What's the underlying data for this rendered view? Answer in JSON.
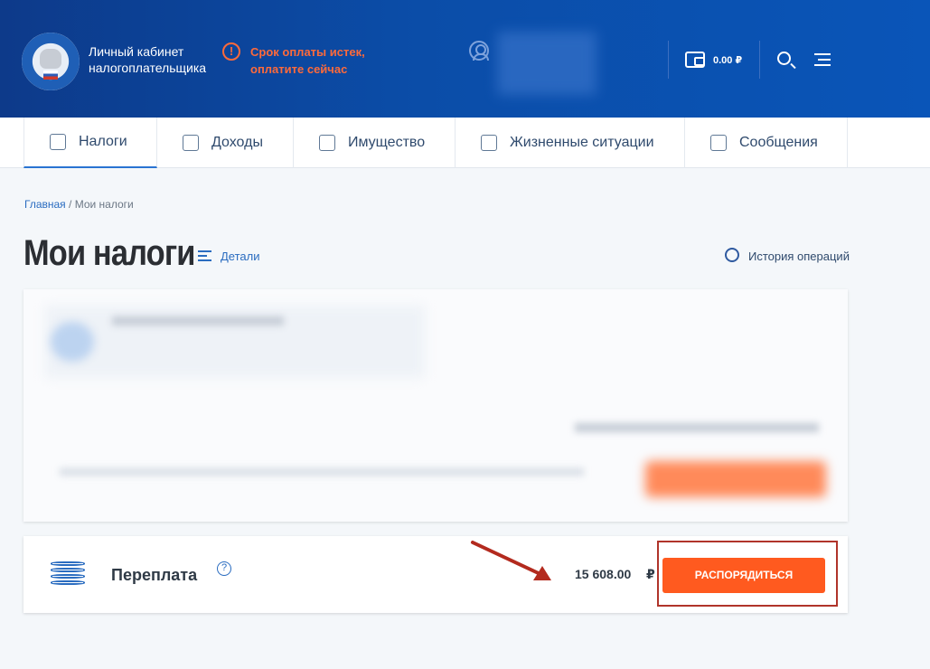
{
  "header": {
    "brand_line1": "Личный кабинет",
    "brand_line2": "налогоплательщика",
    "alert_line1": "Срок оплаты истек,",
    "alert_line2": "оплатите сейчас",
    "alert_icon": "!",
    "balance": "0.00 ₽"
  },
  "nav": {
    "tabs": [
      {
        "label": "Налоги",
        "icon": "tax-doc-icon"
      },
      {
        "label": "Доходы",
        "icon": "coins-icon"
      },
      {
        "label": "Имущество",
        "icon": "property-icon"
      },
      {
        "label": "Жизненные ситуации",
        "icon": "life-situations-icon"
      },
      {
        "label": "Сообщения",
        "icon": "messages-icon"
      }
    ]
  },
  "breadcrumb": {
    "home": "Главная",
    "current": "Мои налоги",
    "sep": " / "
  },
  "page": {
    "title": "Мои налоги",
    "details": "Детали",
    "history": "История операций"
  },
  "overpay": {
    "label": "Переплата",
    "help": "?",
    "amount": "15 608.00",
    "currency": "₽",
    "button": "РАСПОРЯДИТЬСЯ"
  },
  "colors": {
    "accent": "#ff5a1f",
    "header": "#0b4da8",
    "link": "#2a6cc0"
  }
}
